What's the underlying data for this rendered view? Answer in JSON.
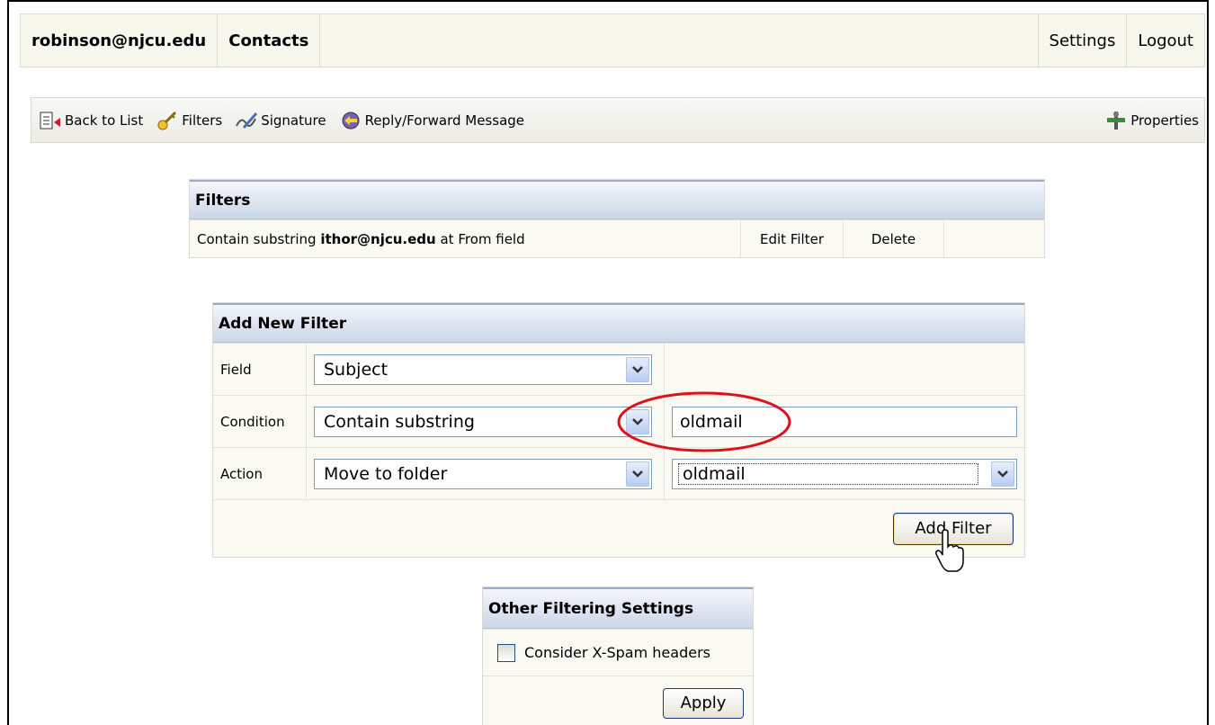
{
  "header": {
    "account": "robinson@njcu.edu",
    "contacts": "Contacts",
    "settings": "Settings",
    "logout": "Logout"
  },
  "toolbar": {
    "back": "Back to List",
    "filters": "Filters",
    "signature": "Signature",
    "reply_forward": "Reply/Forward Message",
    "properties": "Properties"
  },
  "filters": {
    "title": "Filters",
    "rules": [
      {
        "prefix": "Contain substring ",
        "value": "ithor@njcu.edu",
        "suffix": " at From field",
        "edit": "Edit Filter",
        "delete": "Delete"
      }
    ]
  },
  "add_filter": {
    "title": "Add New Filter",
    "field_label": "Field",
    "field_value": "Subject",
    "condition_label": "Condition",
    "condition_value": "Contain substring",
    "condition_text": "oldmail",
    "action_label": "Action",
    "action_value": "Move to folder",
    "folder_value": "oldmail",
    "submit": "Add Filter"
  },
  "other": {
    "title": "Other Filtering Settings",
    "spam_label": "Consider X-Spam headers",
    "spam_checked": false,
    "apply": "Apply"
  },
  "colors": {
    "highlight_circle": "#e0101a",
    "header_gradient_end": "#cbd6e8"
  },
  "icons": [
    "back-to-list-icon",
    "filters-key-icon",
    "signature-icon",
    "reply-forward-icon",
    "properties-tools-icon",
    "chevron-down-icon",
    "hand-cursor-icon"
  ]
}
